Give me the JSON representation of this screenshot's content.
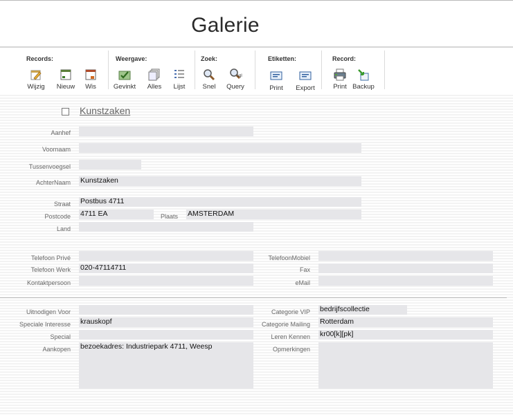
{
  "window": {
    "title": "Galerie"
  },
  "toolbar": {
    "groups": [
      {
        "label": "Records:",
        "buttons": [
          "Wijzig",
          "Nieuw",
          "Wis"
        ]
      },
      {
        "label": "Weergave:",
        "buttons": [
          "Gevinkt",
          "Alles",
          "Lijst"
        ]
      },
      {
        "label": "Zoek:",
        "buttons": [
          "Snel",
          "Query"
        ]
      },
      {
        "label": "Etiketten:",
        "buttons": [
          "Print",
          "Export"
        ]
      },
      {
        "label": "Record:",
        "buttons": [
          "Print",
          "Backup"
        ]
      }
    ],
    "icons": [
      "edit-icon",
      "new-record-icon",
      "delete-icon",
      "checked-icon",
      "all-records-icon",
      "list-icon",
      "quick-search-icon",
      "sql-query-icon",
      "label-print-icon",
      "label-export-icon",
      "print-icon",
      "backup-icon"
    ],
    "query_icon_text": "sql"
  },
  "record": {
    "title": "Kunstzaken",
    "checked": false
  },
  "labels": {
    "aanhef": "Aanhef",
    "voornaam": "Voornaam",
    "tussenvoegsel": "Tussenvoegsel",
    "achternaam": "AchterNaam",
    "straat": "Straat",
    "postcode": "Postcode",
    "plaats": "Plaats",
    "land": "Land",
    "telefoon_prive": "Telefoon Privé",
    "telefoon_werk": "Telefoon Werk",
    "kontaktpersoon": "Kontaktpersoon",
    "telefoon_mobiel": "TelefoonMobiel",
    "fax": "Fax",
    "email": "eMail",
    "uitnodigen_voor": "Uitnodigen Voor",
    "speciale_interesse": "Speciale Interesse",
    "special": "Special",
    "aankopen": "Aankopen",
    "categorie_vip": "Categorie VIP",
    "categorie_mailing": "Categorie Mailing",
    "leren_kennen": "Leren Kennen",
    "opmerkingen": "Opmerkingen"
  },
  "values": {
    "aanhef": "",
    "voornaam": "",
    "tussenvoegsel": "",
    "achternaam": "Kunstzaken",
    "straat": "Postbus 4711",
    "postcode": "4711 EA",
    "plaats": "AMSTERDAM",
    "land": "",
    "telefoon_prive": "",
    "telefoon_werk": "020-47114711",
    "kontaktpersoon": "",
    "telefoon_mobiel": "",
    "fax": "",
    "email": "",
    "uitnodigen_voor": "",
    "speciale_interesse": "krauskopf",
    "special": "",
    "aankopen": "bezoekadres: Industriepark 4711, Weesp",
    "categorie_vip": "bedrijfscollectie",
    "categorie_mailing": "Rotterdam",
    "leren_kennen": "kr00[k][pk]",
    "opmerkingen": ""
  }
}
